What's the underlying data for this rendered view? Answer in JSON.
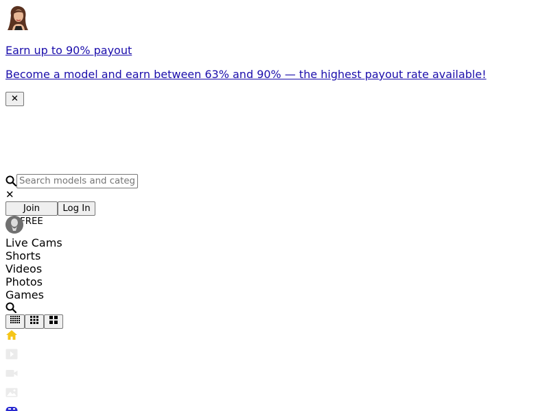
{
  "promo": {
    "headline": "Earn up to 90% payout",
    "subtext": "Become a model and earn between 63% and 90% — the highest payout rate available!",
    "close_label": "✕"
  },
  "search": {
    "placeholder": "Search models and categories",
    "clear_label": "✕"
  },
  "auth": {
    "join_label": "Join FREE",
    "login_label": "Log In"
  },
  "nav": {
    "items": [
      {
        "label": "Live Cams"
      },
      {
        "label": "Shorts"
      },
      {
        "label": "Videos"
      },
      {
        "label": "Photos"
      },
      {
        "label": "Games"
      }
    ]
  },
  "view_toggles": [
    {
      "icon": "grid-small-icon"
    },
    {
      "icon": "grid-medium-icon"
    },
    {
      "icon": "grid-large-icon"
    }
  ],
  "sidebar_icons": [
    {
      "icon": "home-icon",
      "color": "#f5c518"
    },
    {
      "icon": "play-icon",
      "color": "#e8e8e8"
    },
    {
      "icon": "camera-icon",
      "color": "#e8e8e8"
    },
    {
      "icon": "image-icon",
      "color": "#e8e8e8"
    },
    {
      "icon": "gamepad-icon",
      "color": "#2a2ad0"
    }
  ],
  "colors": {
    "link": "#1a0dab",
    "accent": "#f5c518"
  }
}
